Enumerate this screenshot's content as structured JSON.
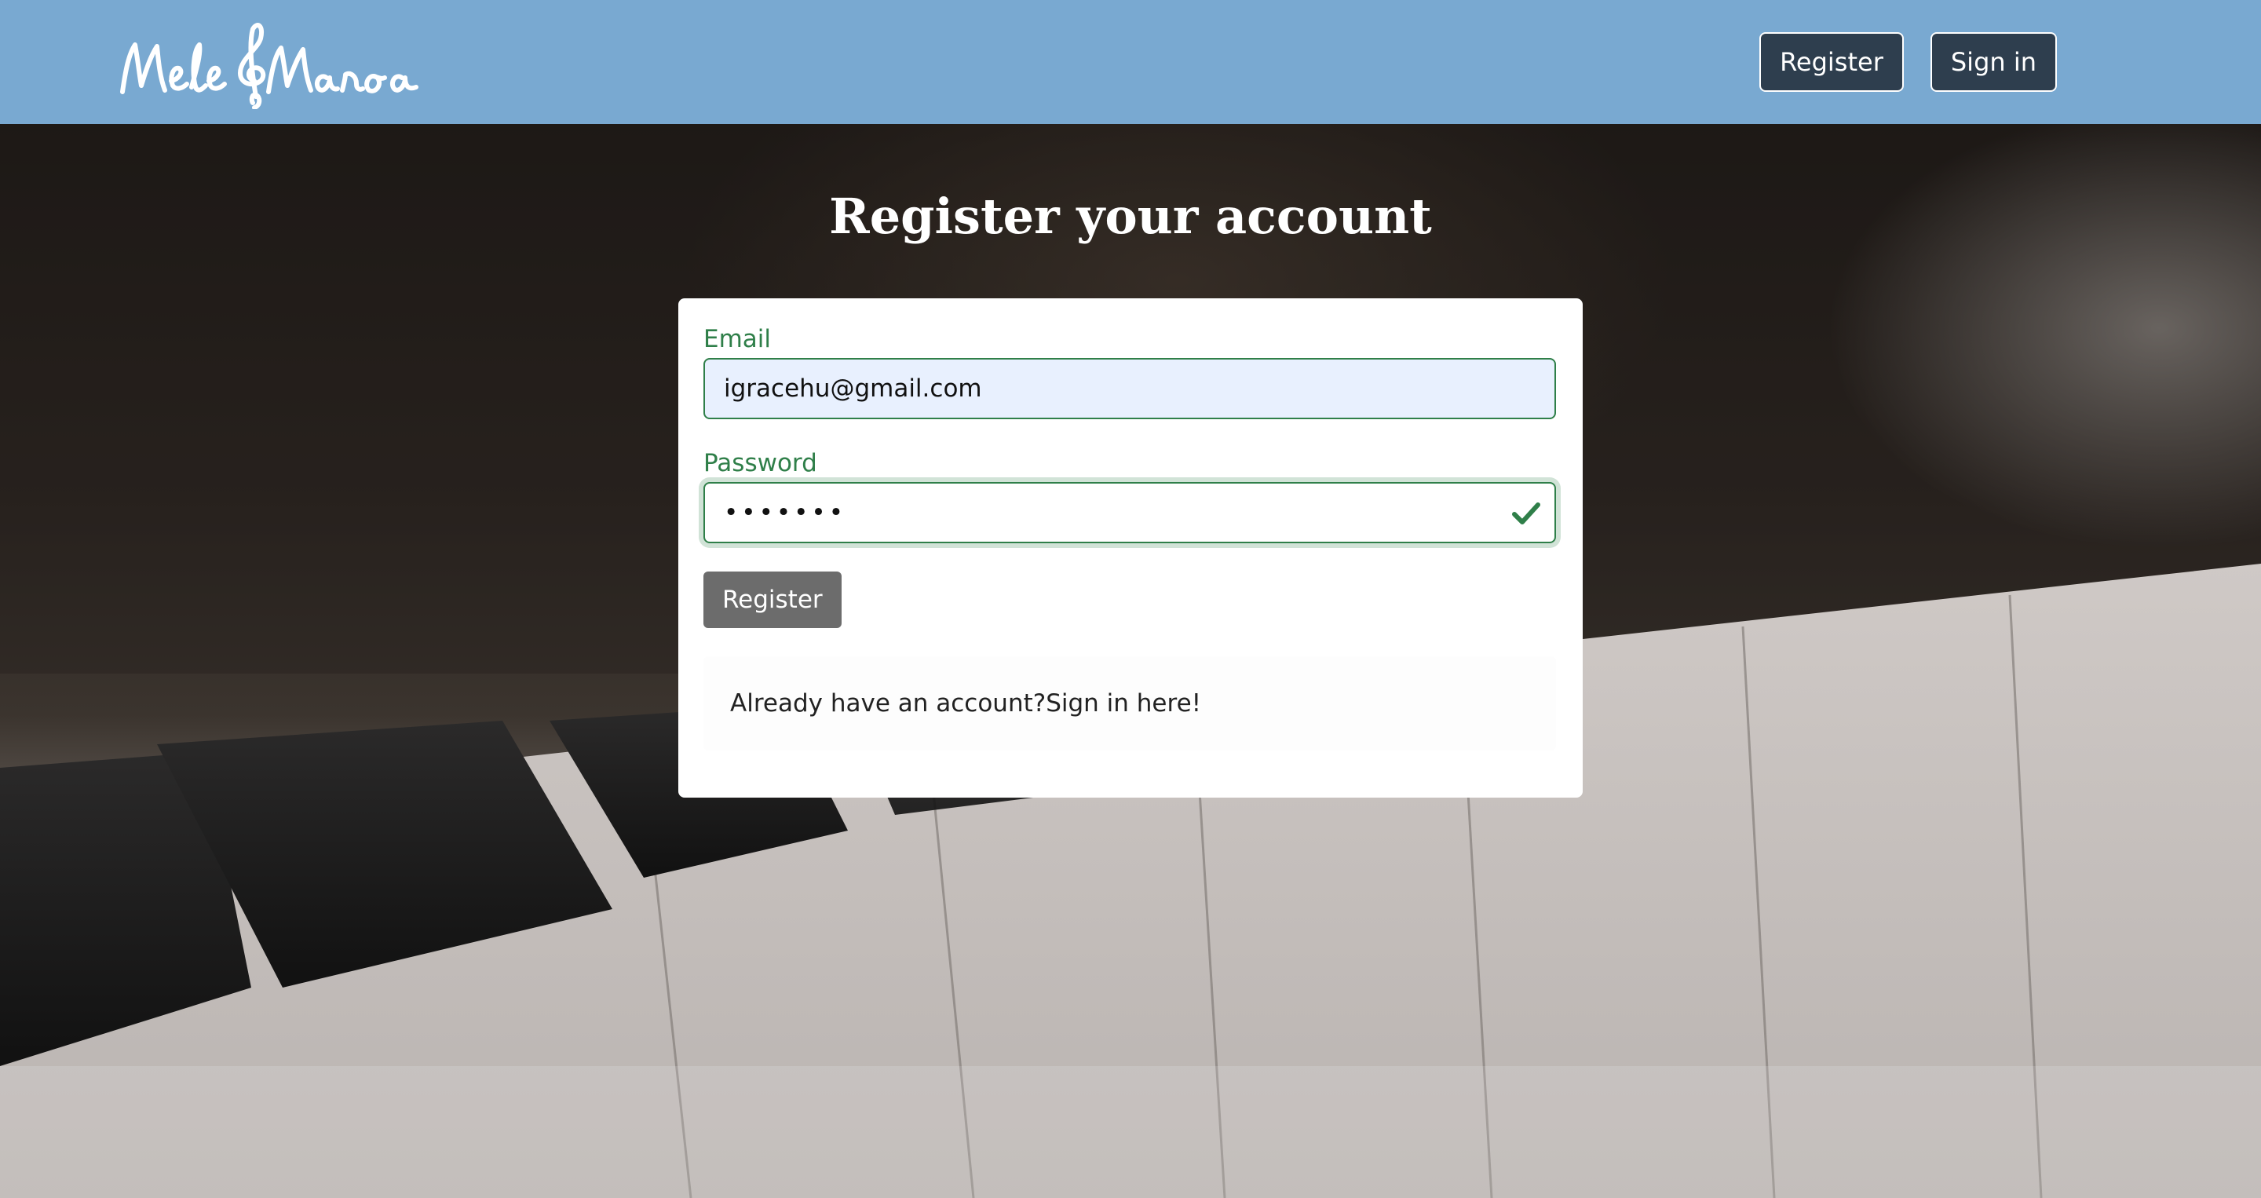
{
  "app": {
    "logo_text": "Mele&Manoa"
  },
  "nav": {
    "register_label": "Register",
    "signin_label": "Sign in"
  },
  "page": {
    "title": "Register your account"
  },
  "form": {
    "email_label": "Email",
    "email_value": "igracehu@gmail.com",
    "password_label": "Password",
    "password_value": "•••••••",
    "password_status_icon": "check-icon",
    "submit_label": "Register"
  },
  "footer_message": {
    "prefix": "Already have an account? ",
    "link_text": "Sign in here!"
  },
  "colors": {
    "navbar": "#79a9d1",
    "nav_button": "#2e3e4e",
    "valid_green": "#2f7f49",
    "submit_button": "#6c6c6c"
  }
}
